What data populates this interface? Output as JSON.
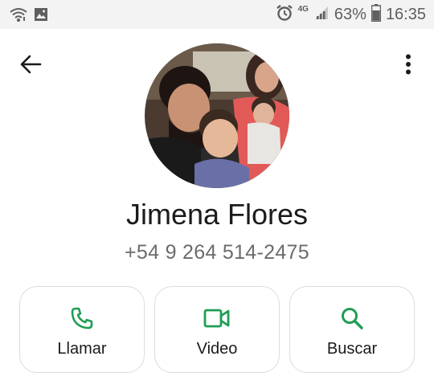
{
  "status_bar": {
    "network_type": "4G",
    "battery_percent": "63%",
    "time": "16:35",
    "icons": [
      "wifi-icon",
      "image-notification-icon",
      "alarm-icon",
      "signal-icon",
      "battery-icon"
    ]
  },
  "contact": {
    "name": "Jimena Flores",
    "phone": "+54 9 264 514-2475"
  },
  "actions": [
    {
      "label": "Llamar",
      "icon": "phone-icon"
    },
    {
      "label": "Video",
      "icon": "video-icon"
    },
    {
      "label": "Buscar",
      "icon": "search-icon"
    }
  ],
  "colors": {
    "accent": "#1f9d55",
    "status_bar_bg": "#f3f3f3",
    "text_primary": "#1b1b1b",
    "text_secondary": "#6b6b6b"
  }
}
